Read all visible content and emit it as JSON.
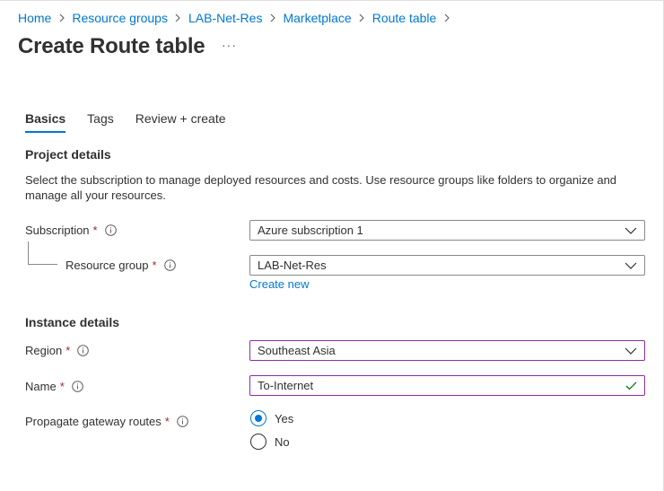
{
  "breadcrumb": {
    "items": [
      "Home",
      "Resource groups",
      "LAB-Net-Res",
      "Marketplace",
      "Route table"
    ]
  },
  "header": {
    "title": "Create Route table",
    "more_label": "···"
  },
  "tabs": [
    {
      "label": "Basics",
      "active": true
    },
    {
      "label": "Tags",
      "active": false
    },
    {
      "label": "Review + create",
      "active": false
    }
  ],
  "project": {
    "heading": "Project details",
    "description": "Select the subscription to manage deployed resources and costs. Use resource groups like folders to organize and manage all your resources.",
    "subscription": {
      "label": "Subscription",
      "required": "*",
      "value": "Azure subscription 1"
    },
    "resource_group": {
      "label": "Resource group",
      "required": "*",
      "value": "LAB-Net-Res"
    },
    "create_new": "Create new"
  },
  "instance": {
    "heading": "Instance details",
    "region": {
      "label": "Region",
      "required": "*",
      "value": "Southeast Asia"
    },
    "name": {
      "label": "Name",
      "required": "*",
      "value": "To-Internet"
    },
    "propagate": {
      "label": "Propagate gateway routes",
      "required": "*",
      "options": [
        {
          "label": "Yes",
          "selected": true
        },
        {
          "label": "No",
          "selected": false
        }
      ]
    }
  },
  "colors": {
    "accent": "#0078d4",
    "required": "#a4262c",
    "focus_border": "#8b2ca5",
    "valid_check": "#107c10"
  },
  "icons": {
    "info": "info-icon",
    "dropdown": "chevron-down-icon",
    "valid": "checkmark-icon",
    "separator": "chevron-right-icon"
  }
}
